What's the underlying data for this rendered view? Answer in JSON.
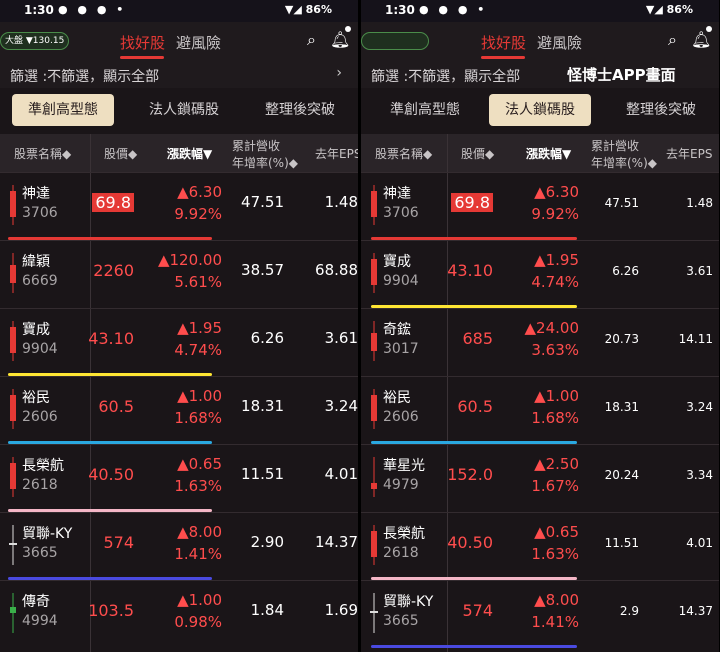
{
  "status": {
    "time": "1:30",
    "battery": "86%"
  },
  "market": {
    "label": "大盤",
    "change": "▼130.15"
  },
  "tabs": {
    "find": "找好股",
    "avoid": "避風險"
  },
  "filter": {
    "text": "篩選 :不篩選，顯示全部",
    "annotation": "怪博士APP畫面"
  },
  "segments": [
    "準創高型態",
    "法人鎖碼股",
    "整理後突破"
  ],
  "headers": {
    "name": "股票名稱",
    "price": "股價",
    "change": "漲跌幅",
    "rev1": "累計營收",
    "rev2": "年增率(%)",
    "eps": "去年EPS"
  },
  "colors": {
    "up": "#ff4d4d",
    "yellow": "#ffe633",
    "blue": "#2aa8e0",
    "pink": "#f4b6c6",
    "indigo": "#4a4ae0",
    "red": "#e53935"
  },
  "left": {
    "rows": [
      {
        "name": "神達",
        "code": "3706",
        "price": "69.8",
        "chg": "▲6.30",
        "pct": "9.92%",
        "rev": "47.51",
        "eps": "1.48",
        "boxed": true,
        "uline": "red",
        "candle": "red"
      },
      {
        "name": "緯穎",
        "code": "6669",
        "price": "2260",
        "chg": "▲120.00",
        "pct": "5.61%",
        "rev": "38.57",
        "eps": "68.88",
        "boxed": false,
        "uline": "",
        "candle": "red-thin"
      },
      {
        "name": "寶成",
        "code": "9904",
        "price": "43.10",
        "chg": "▲1.95",
        "pct": "4.74%",
        "rev": "6.26",
        "eps": "3.61",
        "boxed": false,
        "uline": "yellow",
        "candle": "red"
      },
      {
        "name": "裕民",
        "code": "2606",
        "price": "60.5",
        "chg": "▲1.00",
        "pct": "1.68%",
        "rev": "18.31",
        "eps": "3.24",
        "boxed": false,
        "uline": "blue",
        "candle": "red"
      },
      {
        "name": "長榮航",
        "code": "2618",
        "price": "40.50",
        "chg": "▲0.65",
        "pct": "1.63%",
        "rev": "11.51",
        "eps": "4.01",
        "boxed": false,
        "uline": "pink",
        "candle": "red"
      },
      {
        "name": "貿聯-KY",
        "code": "3665",
        "price": "574",
        "chg": "▲8.00",
        "pct": "1.41%",
        "rev": "2.90",
        "eps": "14.37",
        "boxed": false,
        "uline": "indigo",
        "candle": "white"
      },
      {
        "name": "傳奇",
        "code": "4994",
        "price": "103.5",
        "chg": "▲1.00",
        "pct": "0.98%",
        "rev": "1.84",
        "eps": "1.69",
        "boxed": false,
        "uline": "",
        "candle": "green"
      }
    ]
  },
  "right": {
    "rows": [
      {
        "name": "神達",
        "code": "3706",
        "price": "69.8",
        "chg": "▲6.30",
        "pct": "9.92%",
        "rev": "47.51",
        "eps": "1.48",
        "boxed": true,
        "uline": "red",
        "candle": "red"
      },
      {
        "name": "寶成",
        "code": "9904",
        "price": "43.10",
        "chg": "▲1.95",
        "pct": "4.74%",
        "rev": "6.26",
        "eps": "3.61",
        "boxed": false,
        "uline": "yellow",
        "candle": "red"
      },
      {
        "name": "奇鋐",
        "code": "3017",
        "price": "685",
        "chg": "▲24.00",
        "pct": "3.63%",
        "rev": "20.73",
        "eps": "14.11",
        "boxed": false,
        "uline": "",
        "candle": "red-thin"
      },
      {
        "name": "裕民",
        "code": "2606",
        "price": "60.5",
        "chg": "▲1.00",
        "pct": "1.68%",
        "rev": "18.31",
        "eps": "3.24",
        "boxed": false,
        "uline": "blue",
        "candle": "red"
      },
      {
        "name": "華星光",
        "code": "4979",
        "price": "152.0",
        "chg": "▲2.50",
        "pct": "1.67%",
        "rev": "20.24",
        "eps": "3.34",
        "boxed": false,
        "uline": "",
        "candle": "red-low"
      },
      {
        "name": "長榮航",
        "code": "2618",
        "price": "40.50",
        "chg": "▲0.65",
        "pct": "1.63%",
        "rev": "11.51",
        "eps": "4.01",
        "boxed": false,
        "uline": "pink",
        "candle": "red"
      },
      {
        "name": "貿聯-KY",
        "code": "3665",
        "price": "574",
        "chg": "▲8.00",
        "pct": "1.41%",
        "rev": "2.9",
        "eps": "14.37",
        "boxed": false,
        "uline": "indigo",
        "candle": "white"
      }
    ]
  }
}
